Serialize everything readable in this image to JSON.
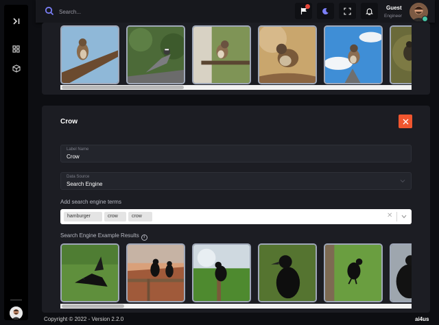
{
  "search": {
    "placeholder": "Search..."
  },
  "user": {
    "name": "Guest",
    "role": "Engineer"
  },
  "colors": {
    "accent": "#7b7ff7",
    "close": "#f0562f",
    "notification": "#e5473a",
    "online": "#45c3a4"
  },
  "sidebar": {
    "icons": [
      "collapse-sidebar-icon",
      "dashboard-grid-icon",
      "cube-icon"
    ]
  },
  "header": {
    "icons": [
      "flag-icon",
      "moon-icon",
      "fullscreen-icon",
      "bell-icon"
    ]
  },
  "top_gallery": {
    "items": [
      "sparrow-1",
      "sparrow-2",
      "sparrow-3",
      "sparrow-4",
      "sparrow-5",
      "sparrow-6"
    ],
    "scroll_fraction": 0.35
  },
  "label_panel": {
    "title": "Crow",
    "label_name": {
      "label": "Label Name",
      "value": "Crow"
    },
    "data_source": {
      "label": "Data Source",
      "value": "Search Engine"
    },
    "terms_label": "Add search engine terms",
    "terms": [
      "hamburger",
      "crow",
      "crow"
    ],
    "results_label": "Search Engine Example Results",
    "results": [
      "crow-1",
      "crow-2",
      "crow-3",
      "crow-4",
      "crow-5",
      "crow-6"
    ],
    "scroll_fraction": 0.18
  },
  "footer": {
    "copyright": "Copyright © 2022 - Version 2.2.0",
    "brand": "ai4us"
  }
}
